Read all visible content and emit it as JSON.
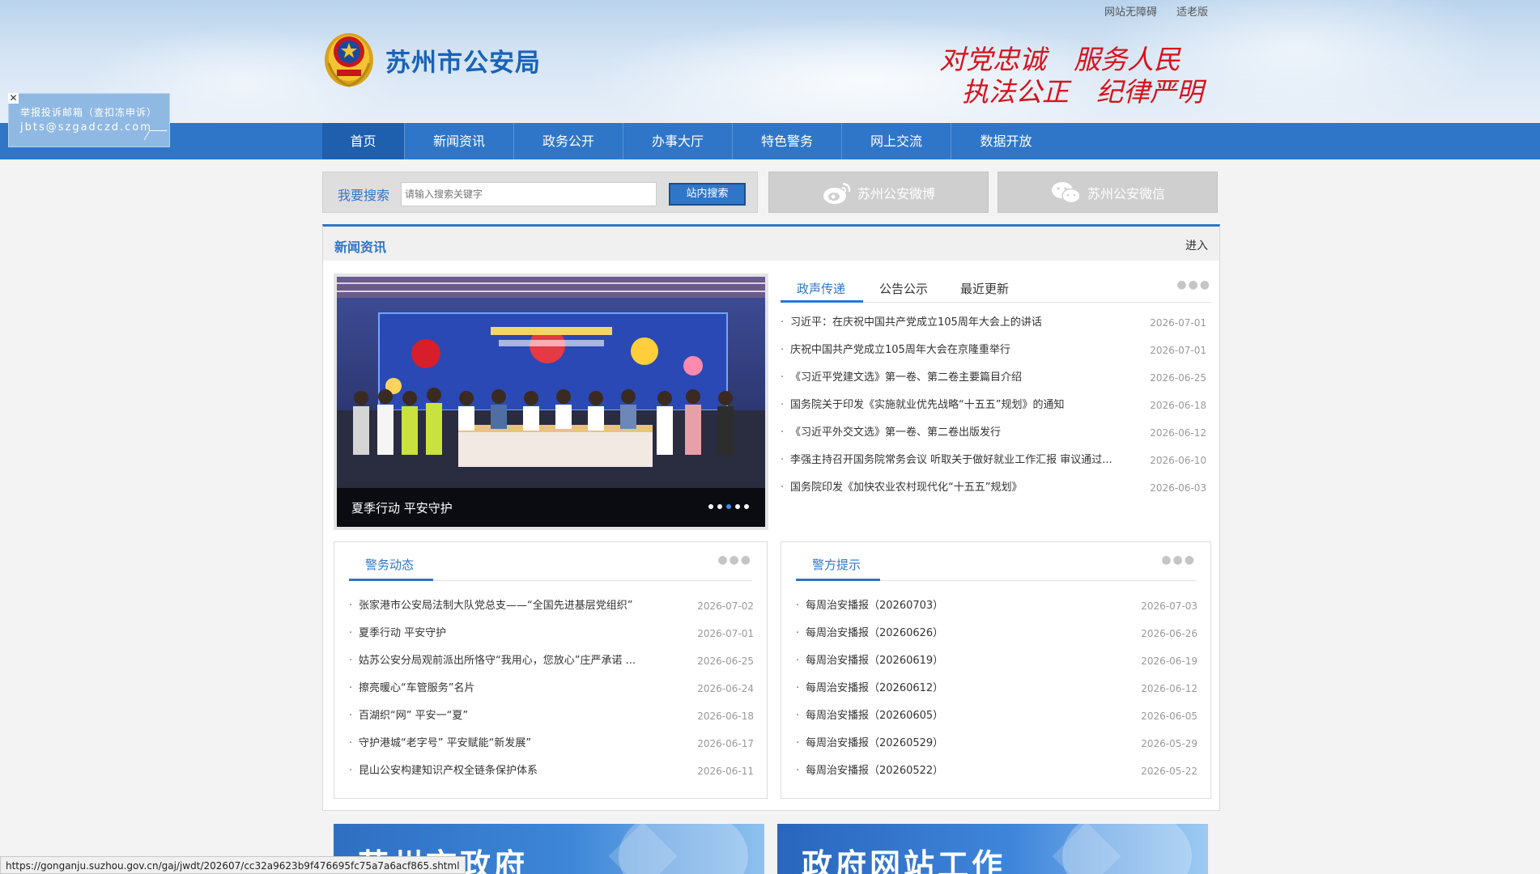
{
  "top_links": [
    "网站无障碍",
    "适老版"
  ],
  "site_title": "苏州市公安局",
  "slogan": {
    "line1a": "对党忠诚",
    "line1b": "服务人民",
    "line2a": "执法公正",
    "line2b": "纪律严明"
  },
  "nav": [
    "首页",
    "新闻资讯",
    "政务公开",
    "办事大厅",
    "特色警务",
    "网上交流",
    "数据开放"
  ],
  "float_box": {
    "line1": "举报投诉邮箱（查扣冻申诉）",
    "line2": "jbts@szgadczd.com"
  },
  "search": {
    "label": "我要搜索",
    "placeholder": "请输入搜索关键字",
    "button": "站内搜索"
  },
  "social": {
    "weibo": "苏州公安微博",
    "wechat": "苏州公安微信"
  },
  "news_panel": {
    "title": "新闻资讯",
    "more": "进入"
  },
  "carousel": {
    "caption": "夏季行动 平安守护",
    "dot_count": 5,
    "active_dot": 2
  },
  "tabs": [
    "政声传递",
    "公告公示",
    "最近更新"
  ],
  "tab_news": [
    {
      "title": "习近平：在庆祝中国共产党成立105周年大会上的讲话",
      "date": "2026-07-01"
    },
    {
      "title": "庆祝中国共产党成立105周年大会在京隆重举行",
      "date": "2026-07-01"
    },
    {
      "title": "《习近平党建文选》第一卷、第二卷主要篇目介绍",
      "date": "2026-06-25"
    },
    {
      "title": "国务院关于印发《实施就业优先战略“十五五”规划》的通知",
      "date": "2026-06-18"
    },
    {
      "title": "《习近平外交文选》第一卷、第二卷出版发行",
      "date": "2026-06-12"
    },
    {
      "title": "李强主持召开国务院常务会议 听取关于做好就业工作汇报 审议通过...",
      "date": "2026-06-10"
    },
    {
      "title": "国务院印发《加快农业农村现代化“十五五”规划》",
      "date": "2026-06-03"
    }
  ],
  "police_news": {
    "title": "警务动态",
    "items": [
      {
        "title": "张家港市公安局法制大队党总支——“全国先进基层党组织”",
        "date": "2026-07-02"
      },
      {
        "title": "夏季行动 平安守护",
        "date": "2026-07-01"
      },
      {
        "title": "姑苏公安分局观前派出所恪守“我用心，您放心”庄严承诺 ...",
        "date": "2026-06-25"
      },
      {
        "title": "擦亮暖心“车管服务”名片",
        "date": "2026-06-24"
      },
      {
        "title": "百湖织“网” 平安一“夏”",
        "date": "2026-06-18"
      },
      {
        "title": "守护港城“老字号” 平安赋能“新发展”",
        "date": "2026-06-17"
      },
      {
        "title": "昆山公安构建知识产权全链条保护体系",
        "date": "2026-06-11"
      }
    ]
  },
  "police_tips": {
    "title": "警方提示",
    "items": [
      {
        "title": "每周治安播报（20260703）",
        "date": "2026-07-03"
      },
      {
        "title": "每周治安播报（20260626）",
        "date": "2026-06-26"
      },
      {
        "title": "每周治安播报（20260619）",
        "date": "2026-06-19"
      },
      {
        "title": "每周治安播报（20260612）",
        "date": "2026-06-12"
      },
      {
        "title": "每周治安播报（20260605）",
        "date": "2026-06-05"
      },
      {
        "title": "每周治安播报（20260529）",
        "date": "2026-05-29"
      },
      {
        "title": "每周治安播报（20260522）",
        "date": "2026-05-22"
      }
    ]
  },
  "banners": [
    "苏州市政府",
    "政府网站工作"
  ],
  "status_url": "https://gonganju.suzhou.gov.cn/gaj/jwdt/202607/cc32a9623b9f476695fc75a7a6acf865.shtml",
  "colors": {
    "primary": "#2f76c8",
    "slogan": "#d6121c",
    "nav_active": "#1e5fae"
  }
}
